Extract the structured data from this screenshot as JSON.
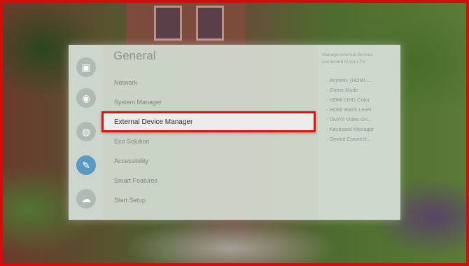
{
  "colors": {
    "highlight_border": "#d61616",
    "active_icon": "#5a9ac2"
  },
  "rail": [
    {
      "icon": "picture-icon",
      "glyph": "▣"
    },
    {
      "icon": "sound-icon",
      "glyph": "◉"
    },
    {
      "icon": "broadcast-icon",
      "glyph": "◍"
    },
    {
      "icon": "general-wrench-icon",
      "glyph": "✎"
    },
    {
      "icon": "support-icon",
      "glyph": "☁"
    }
  ],
  "menu": {
    "title": "General",
    "items": [
      "Network",
      "System Manager",
      "External Device Manager",
      "Eco Solution",
      "Accessibility",
      "Smart Features",
      "Start Setup"
    ],
    "selected_index": 2
  },
  "info": {
    "description": "Manage external devices connected to your TV.",
    "items": [
      "Anynet+ (HDMI-...",
      "Game Mode",
      "HDMI UHD Color",
      "HDMI Black Level",
      "DivX® Video On...",
      "Keyboard Manager",
      "Device Connect..."
    ]
  }
}
